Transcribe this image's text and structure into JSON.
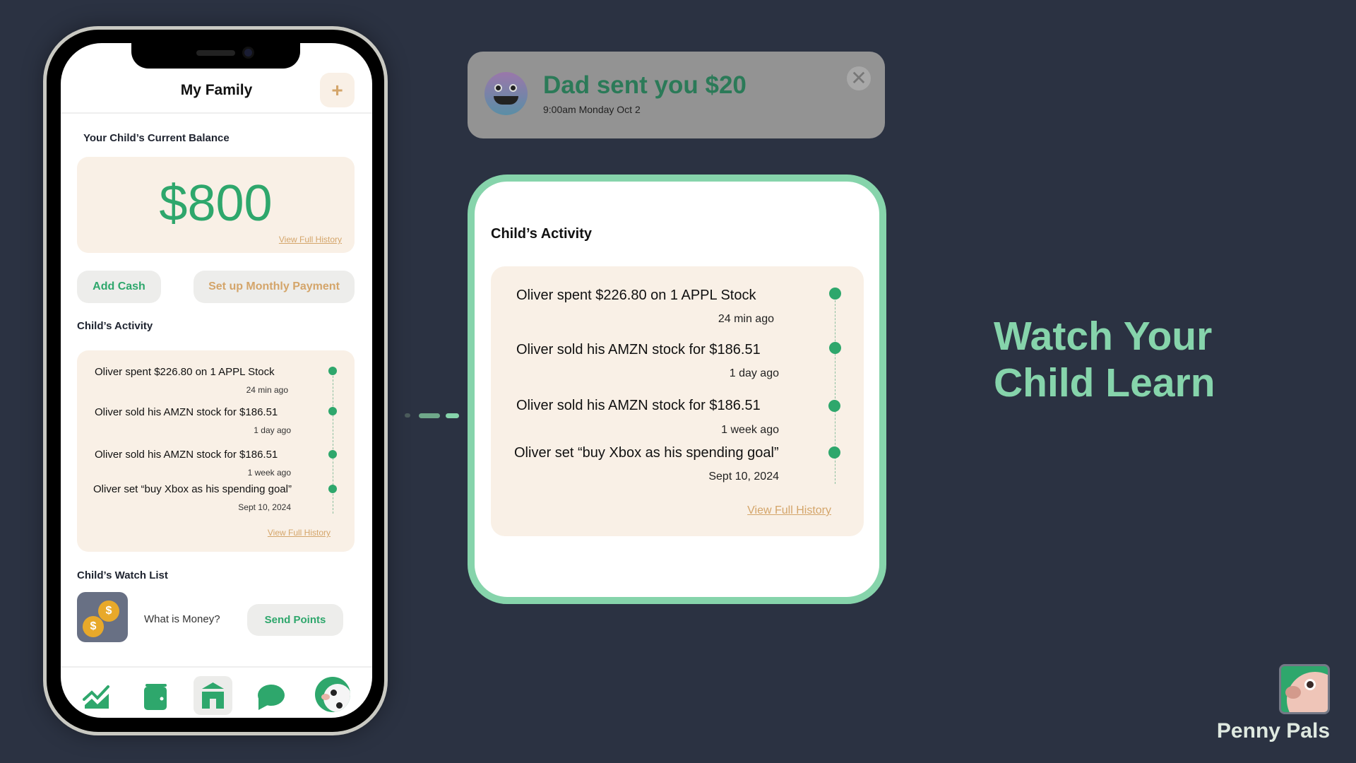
{
  "phone": {
    "header": {
      "title": "My Family",
      "add_label": "+"
    },
    "balance": {
      "label": "Your Child’s Current Balance",
      "amount": "$800",
      "history_link": "View Full History"
    },
    "buttons": {
      "add_cash": "Add Cash",
      "monthly": "Set up Monthly Payment"
    },
    "activity": {
      "title": "Child’s Activity",
      "items": [
        {
          "text": "Oliver spent $226.80 on 1 APPL Stock",
          "time": "24 min ago"
        },
        {
          "text": "Oliver sold his AMZN stock for $186.51",
          "time": "1 day ago"
        },
        {
          "text": "Oliver sold his AMZN stock for $186.51",
          "time": "1 week ago"
        },
        {
          "text": "Oliver set “buy Xbox as his spending goal”",
          "time": "Sept 10, 2024"
        }
      ],
      "history_link": "View Full History"
    },
    "watchlist": {
      "title": "Child’s Watch List",
      "item": "What is Money?",
      "send": "Send Points"
    },
    "tabbar": [
      "chart-icon",
      "wallet-icon",
      "home-icon",
      "chat-icon",
      "cow-avatar"
    ]
  },
  "notification": {
    "title": "Dad sent you $20",
    "time": "9:00am Monday Oct 2"
  },
  "panel": {
    "title": "Child’s Activity",
    "items": [
      {
        "text": "Oliver spent $226.80 on 1 APPL Stock",
        "time": "24 min ago"
      },
      {
        "text": "Oliver sold his AMZN stock for $186.51",
        "time": "1 day ago"
      },
      {
        "text": "Oliver sold his AMZN stock for $186.51",
        "time": "1 week ago"
      },
      {
        "text": "Oliver set “buy Xbox as his spending goal”",
        "time": "Sept 10, 2024"
      }
    ],
    "history_link": "View Full History"
  },
  "tagline": {
    "line1": "Watch Your",
    "line2": "Child Learn"
  },
  "brand": {
    "name": "Penny Pals"
  },
  "colors": {
    "background": "#2b3242",
    "green": "#2ea76c",
    "tan": "#d4a56a",
    "cream": "#f9f0e6",
    "mint": "#86d4ab"
  }
}
